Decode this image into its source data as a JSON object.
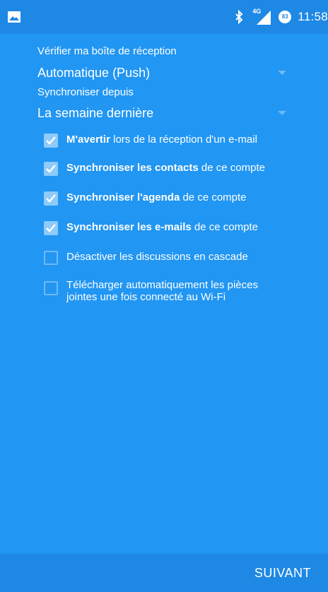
{
  "status_bar": {
    "network": "4G",
    "battery": "83",
    "time": "11:58",
    "icons": [
      "gallery-icon",
      "bluetooth-icon",
      "signal-icon",
      "battery-icon"
    ]
  },
  "sync_settings": {
    "inbox_check_label": "Vérifier ma boîte de réception",
    "inbox_check_value": "Automatique (Push)",
    "sync_since_label": "Synchroniser depuis",
    "sync_since_value": "La semaine dernière"
  },
  "options": [
    {
      "bold": "M'avertir",
      "rest": " lors de la réception d'un e-mail",
      "checked": true
    },
    {
      "bold": "Synchroniser les contacts",
      "rest": " de ce compte",
      "checked": true
    },
    {
      "bold": "Synchroniser l'agenda",
      "rest": " de ce compte",
      "checked": true
    },
    {
      "bold": "Synchroniser les e-mails",
      "rest": " de ce compte",
      "checked": true
    },
    {
      "bold": "",
      "rest": "Désactiver les discussions en cascade",
      "checked": false
    },
    {
      "bold": "",
      "rest": "Télécharger automatiquement les pièces jointes une fois connecté au Wi-Fi",
      "checked": false
    }
  ],
  "footer": {
    "next_label": "SUIVANT"
  },
  "colors": {
    "background": "#2196F3",
    "bars": "#1E88E5",
    "checkbox_checked": "#8ECBFA"
  }
}
